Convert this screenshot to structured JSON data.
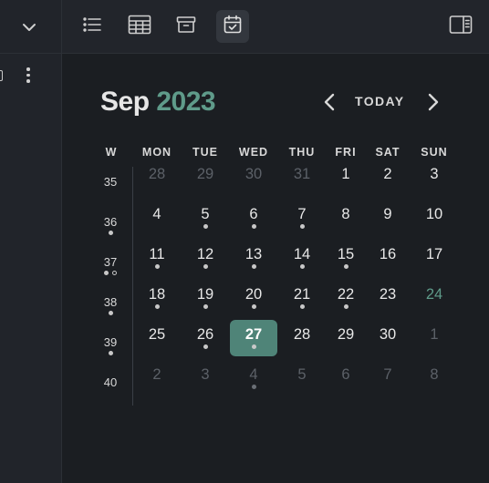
{
  "calendar": {
    "month": "Sep",
    "year": "2023",
    "today_label": "TODAY",
    "week_header": "W",
    "weekdays": [
      "MON",
      "TUE",
      "WED",
      "THU",
      "FRI",
      "SAT",
      "SUN"
    ],
    "accent_color": "#5f9b8a",
    "selected_color": "#4f8478",
    "weeks": [
      {
        "week": "35",
        "week_dots": [],
        "days": [
          {
            "d": "28",
            "out": true,
            "dots": 0
          },
          {
            "d": "29",
            "out": true,
            "dots": 0
          },
          {
            "d": "30",
            "out": true,
            "dots": 0
          },
          {
            "d": "31",
            "out": true,
            "dots": 0
          },
          {
            "d": "1",
            "dots": 0
          },
          {
            "d": "2",
            "dots": 0
          },
          {
            "d": "3",
            "dots": 0
          }
        ]
      },
      {
        "week": "36",
        "week_dots": [
          "filled"
        ],
        "days": [
          {
            "d": "4",
            "dots": 0
          },
          {
            "d": "5",
            "dots": 1
          },
          {
            "d": "6",
            "dots": 1
          },
          {
            "d": "7",
            "dots": 1
          },
          {
            "d": "8",
            "dots": 0
          },
          {
            "d": "9",
            "dots": 0
          },
          {
            "d": "10",
            "dots": 0
          }
        ]
      },
      {
        "week": "37",
        "week_dots": [
          "filled",
          "hollow"
        ],
        "days": [
          {
            "d": "11",
            "dots": 1
          },
          {
            "d": "12",
            "dots": 1
          },
          {
            "d": "13",
            "dots": 1
          },
          {
            "d": "14",
            "dots": 1
          },
          {
            "d": "15",
            "dots": 1
          },
          {
            "d": "16",
            "dots": 0
          },
          {
            "d": "17",
            "dots": 0
          }
        ]
      },
      {
        "week": "38",
        "week_dots": [
          "filled"
        ],
        "days": [
          {
            "d": "18",
            "dots": 1
          },
          {
            "d": "19",
            "dots": 1
          },
          {
            "d": "20",
            "dots": 1
          },
          {
            "d": "21",
            "dots": 1
          },
          {
            "d": "22",
            "dots": 1
          },
          {
            "d": "23",
            "dots": 0
          },
          {
            "d": "24",
            "accent": true,
            "dots": 0
          }
        ]
      },
      {
        "week": "39",
        "week_dots": [
          "filled"
        ],
        "days": [
          {
            "d": "25",
            "dots": 0
          },
          {
            "d": "26",
            "dots": 1
          },
          {
            "d": "27",
            "selected": true,
            "dots": 1
          },
          {
            "d": "28",
            "dots": 0
          },
          {
            "d": "29",
            "dots": 0
          },
          {
            "d": "30",
            "dots": 0
          },
          {
            "d": "1",
            "out": true,
            "dots": 0
          }
        ]
      },
      {
        "week": "40",
        "week_dots": [],
        "days": [
          {
            "d": "2",
            "out": true,
            "dots": 0
          },
          {
            "d": "3",
            "out": true,
            "dots": 0
          },
          {
            "d": "4",
            "out": true,
            "dots": 1
          },
          {
            "d": "5",
            "out": true,
            "dots": 0
          },
          {
            "d": "6",
            "out": true,
            "dots": 0
          },
          {
            "d": "7",
            "out": true,
            "dots": 0
          },
          {
            "d": "8",
            "out": true,
            "dots": 0
          }
        ]
      }
    ]
  },
  "toolbar": {
    "buttons": [
      {
        "icon": "list-icon",
        "active": false
      },
      {
        "icon": "table-icon",
        "active": false
      },
      {
        "icon": "archive-icon",
        "active": false
      },
      {
        "icon": "calendar-icon",
        "active": true
      }
    ],
    "right_icon": "sidebar-toggle-icon"
  },
  "left_panel": {
    "icons": [
      "chevron-down-icon",
      "square-icon",
      "more-vertical-icon"
    ]
  }
}
